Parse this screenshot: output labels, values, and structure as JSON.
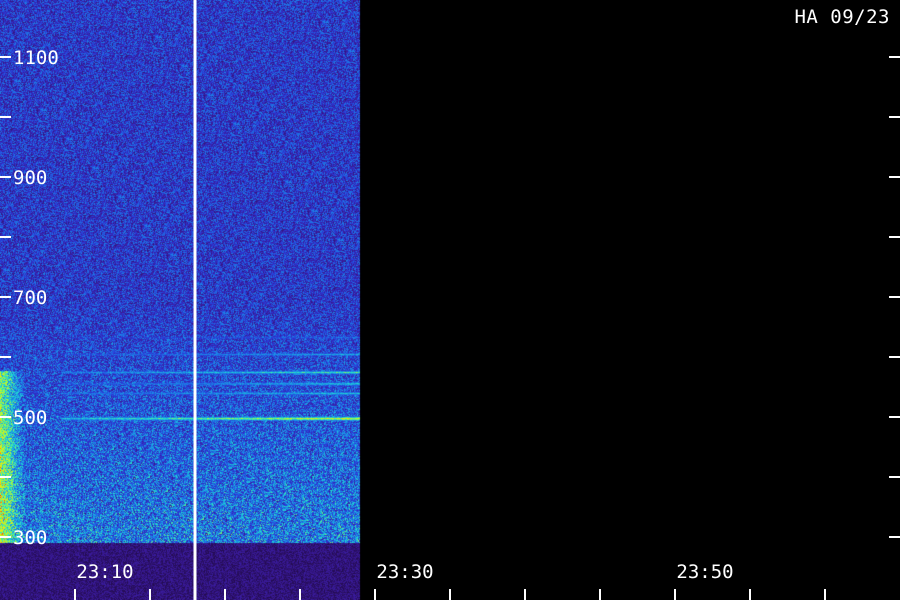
{
  "station_label": "HA 09/23",
  "chart_data": {
    "type": "heatmap",
    "title": "",
    "xlabel": "",
    "ylabel": "",
    "x_axis": {
      "start": "23:03",
      "end": "23:58",
      "tick_labels": [
        {
          "time": "23:10",
          "text": "23:10"
        },
        {
          "time": "23:30",
          "text": "23:30"
        },
        {
          "time": "23:50",
          "text": "23:50"
        }
      ],
      "minor_tick_times": [
        "23:08",
        "23:13",
        "23:18",
        "23:23",
        "23:28",
        "23:33",
        "23:38",
        "23:43",
        "23:48",
        "23:53",
        "23:58"
      ]
    },
    "y_axis": {
      "range": [
        300,
        1180
      ],
      "tick_labels": [
        300,
        500,
        700,
        900,
        1100
      ],
      "ticks": [
        300,
        400,
        500,
        600,
        700,
        800,
        900,
        1000,
        1100
      ]
    },
    "data_span": {
      "start": "23:03",
      "end": "23:27"
    },
    "marker_time": "23:16",
    "colormap": [
      "#1a0530",
      "#3a1a9a",
      "#2a3ad8",
      "#1a8ae8",
      "#20e0d0",
      "#b0ff30",
      "#ffe000",
      "#ff3000"
    ],
    "bands": [
      {
        "freq": 498,
        "intensity_start": 0.55,
        "intensity_end": 0.95
      },
      {
        "freq": 540,
        "intensity_start": 0.35,
        "intensity_end": 0.6
      },
      {
        "freq": 556,
        "intensity_start": 0.3,
        "intensity_end": 0.65
      },
      {
        "freq": 575,
        "intensity_start": 0.4,
        "intensity_end": 0.7
      },
      {
        "freq": 605,
        "intensity_start": 0.3,
        "intensity_end": 0.55
      },
      {
        "freq": 633,
        "intensity_start": 0.25,
        "intensity_end": 0.4
      }
    ]
  }
}
